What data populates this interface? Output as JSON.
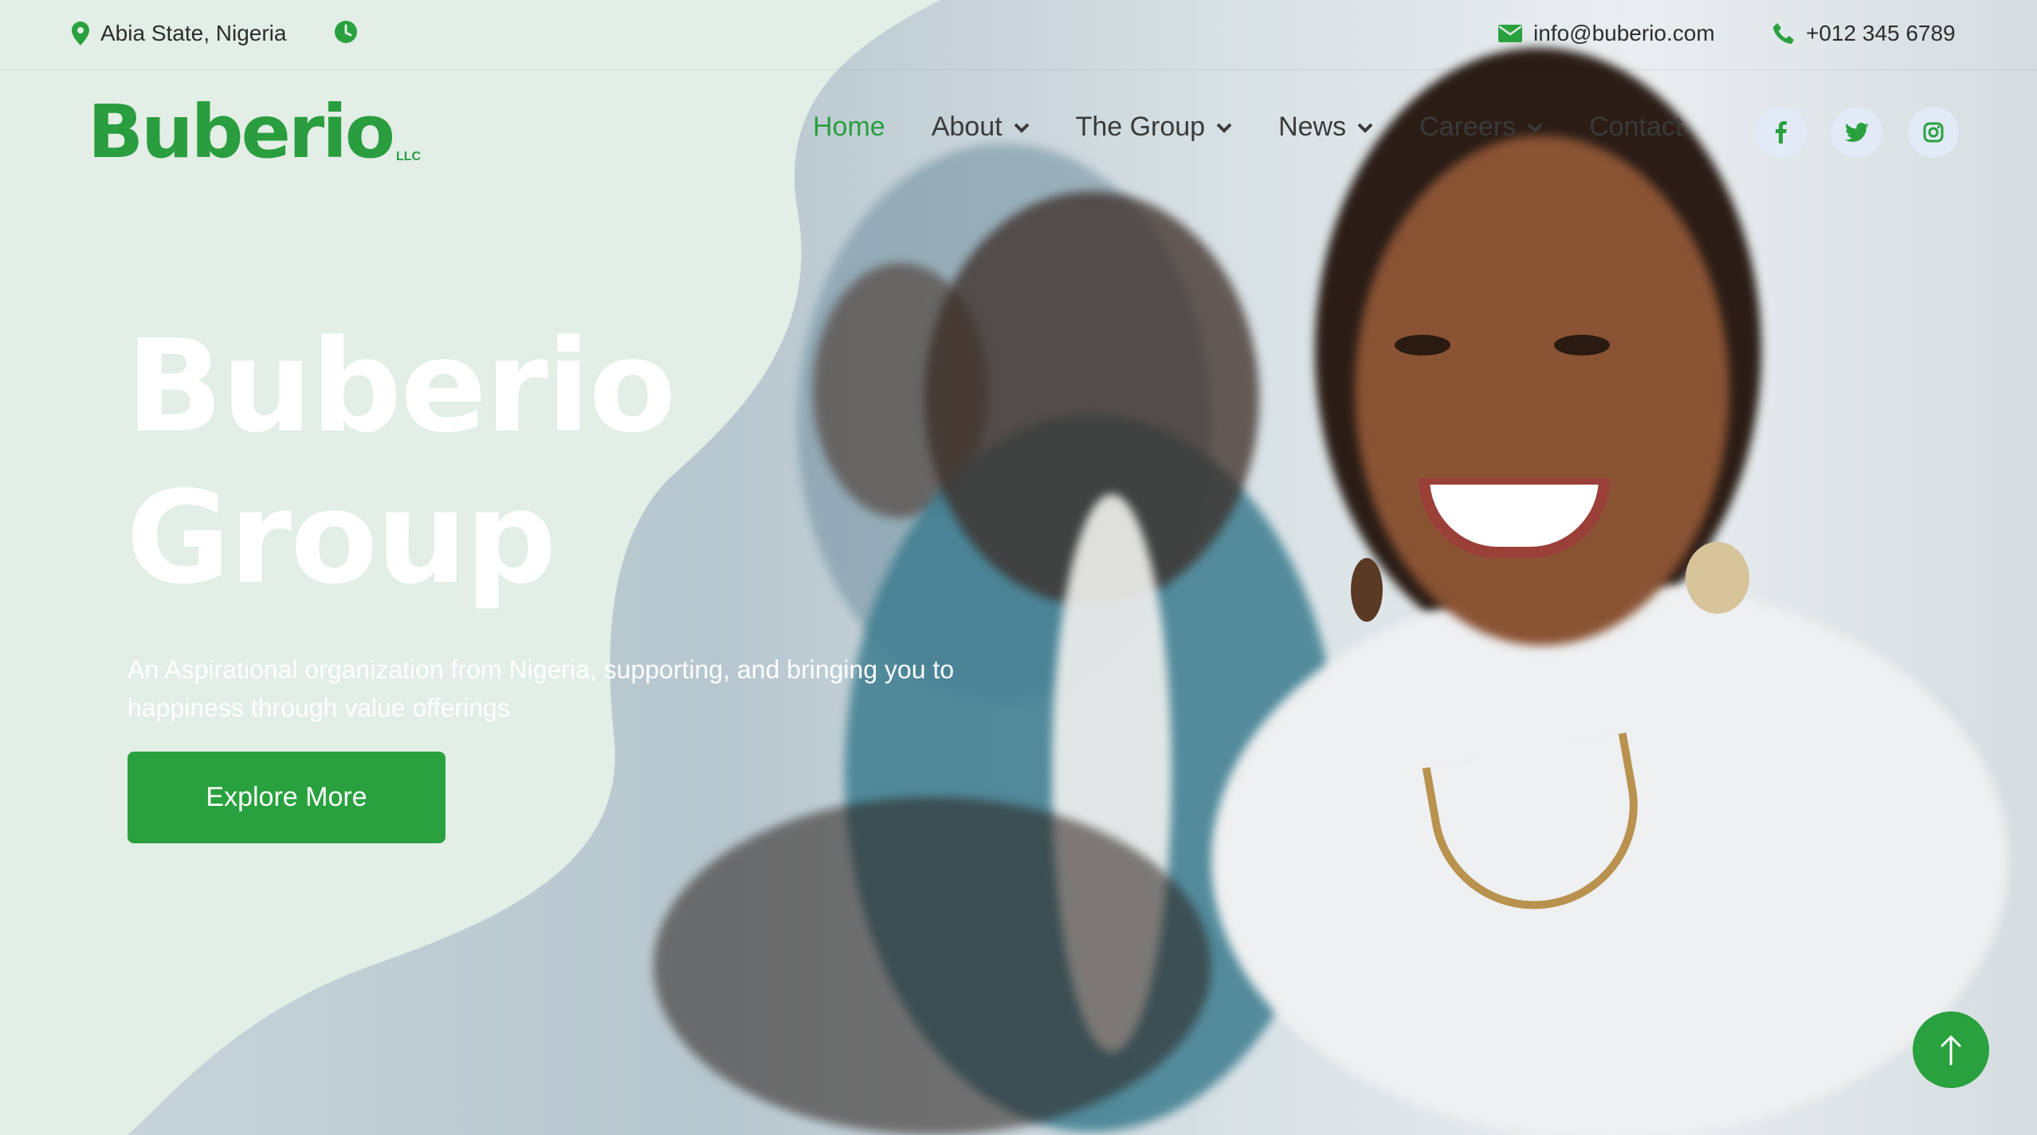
{
  "topbar": {
    "location": "Abia State, Nigeria",
    "email": "info@buberio.com",
    "phone": "+012 345 6789"
  },
  "logo": {
    "text": "Buberio",
    "suffix": "LLC"
  },
  "nav": {
    "items": [
      {
        "label": "Home",
        "active": true,
        "dropdown": false
      },
      {
        "label": "About",
        "dropdown": true
      },
      {
        "label": "The Group",
        "dropdown": true
      },
      {
        "label": "News",
        "dropdown": true
      },
      {
        "label": "Careers",
        "dropdown": true
      },
      {
        "label": "Contact",
        "dropdown": false
      }
    ]
  },
  "social": [
    "facebook-icon",
    "twitter-icon",
    "instagram-icon"
  ],
  "hero": {
    "title_line1": "Buberio",
    "title_line2": "Group",
    "subtitle": "An Aspirational organization from Nigeria, supporting, and bringing you to happiness through value offerings",
    "cta": "Explore More"
  },
  "colors": {
    "brand": "#2aa13f",
    "mint": "#e2eee6"
  }
}
